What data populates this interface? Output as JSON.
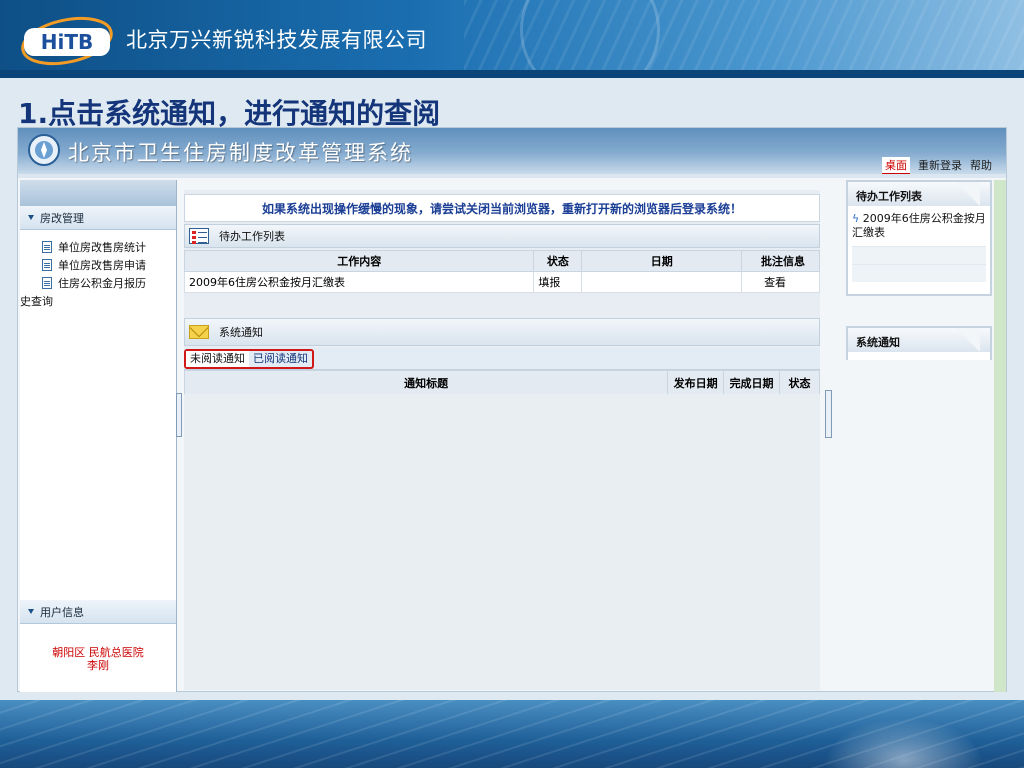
{
  "slide": {
    "company": "北京万兴新锐科技发展有限公司",
    "logo_text": "HiTB",
    "title": "1.点击系统通知，进行通知的查阅"
  },
  "app": {
    "title": "北京市卫生住房制度改革管理系统",
    "top_links": [
      "桌面",
      "重新登录",
      "帮助"
    ],
    "notice_banner": "如果系统出现操作缓慢的现象，请尝试关闭当前浏览器，重新打开新的浏览器后登录系统！"
  },
  "sidebar": {
    "section1_title": "房改管理",
    "items": [
      "单位房改售房统计",
      "单位房改售房申请",
      "住房公积金月报历"
    ],
    "item_tail": "史查询",
    "section2_title": "用户信息",
    "user_org": "朝阳区  民航总医院",
    "user_name": "李刚"
  },
  "work_panel": {
    "title": "待办工作列表",
    "columns": [
      "工作内容",
      "状态",
      "日期",
      "批注信息"
    ],
    "rows": [
      [
        "2009年6住房公积金按月汇缴表",
        "填报",
        "",
        "查看"
      ]
    ]
  },
  "notice_panel": {
    "title": "系统通知",
    "tabs": [
      "未阅读通知",
      "已阅读通知"
    ],
    "columns": [
      "通知标题",
      "发布日期",
      "完成日期",
      "状态"
    ]
  },
  "right_panels": {
    "todo_title": "待办工作列表",
    "todo_item": "2009年6住房公积金按月汇缴表",
    "notice_title": "系统通知"
  },
  "colors": {
    "accent_red": "#d01818",
    "title_blue": "#14357a"
  }
}
